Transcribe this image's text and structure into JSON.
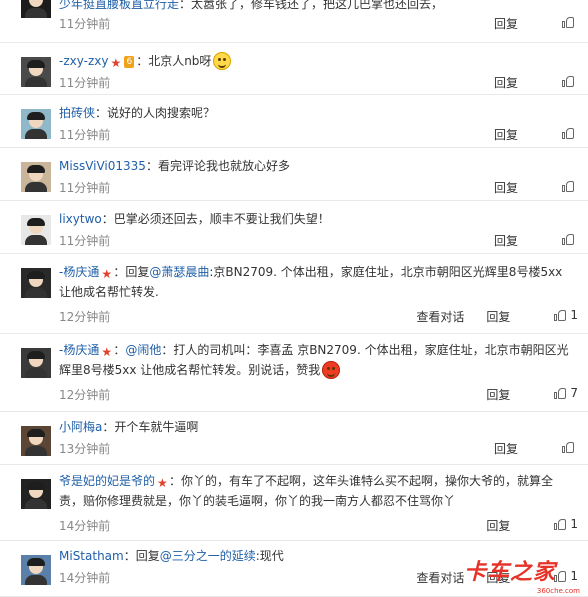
{
  "comments": [
    {
      "user": "少年挺直腰板直立行走",
      "vip": false,
      "parts": [
        {
          "t": "text",
          "v": "太嚣张了，修车钱还了，把这几巴掌也还回去，"
        }
      ],
      "time": "11分钟前",
      "actions": [
        "回复"
      ],
      "likes": ""
    },
    {
      "user": "-zxy-zxy",
      "vip": true,
      "badge": "6",
      "parts": [
        {
          "t": "text",
          "v": "北京人nb呀"
        },
        {
          "t": "emoji",
          "v": "smile"
        }
      ],
      "time": "11分钟前",
      "actions": [
        "回复"
      ],
      "likes": ""
    },
    {
      "user": "拍砖侠",
      "vip": false,
      "parts": [
        {
          "t": "text",
          "v": "说好的人肉搜索呢？"
        }
      ],
      "time": "11分钟前",
      "actions": [
        "回复"
      ],
      "likes": ""
    },
    {
      "user": "MissViVi01335",
      "vip": false,
      "parts": [
        {
          "t": "text",
          "v": "看完评论我也就放心好多"
        }
      ],
      "time": "11分钟前",
      "actions": [
        "回复"
      ],
      "likes": ""
    },
    {
      "user": "lixytwo",
      "vip": false,
      "parts": [
        {
          "t": "text",
          "v": "巴掌必须还回去，顺丰不要让我们失望！"
        }
      ],
      "time": "11分钟前",
      "actions": [
        "回复"
      ],
      "likes": ""
    },
    {
      "user": "-杨庆通",
      "vip": true,
      "parts": [
        {
          "t": "text",
          "v": "回复"
        },
        {
          "t": "mention",
          "v": "@萧瑟晨曲"
        },
        {
          "t": "text",
          "v": ":京BN2709. 个体出租，家庭住址，北京市朝阳区光辉里8号楼5xx 让他成名帮忙转发."
        }
      ],
      "time": "12分钟前",
      "actions": [
        "查看对话",
        "回复"
      ],
      "likes": "1"
    },
    {
      "user": "-杨庆通",
      "vip": true,
      "parts": [
        {
          "t": "mention",
          "v": "@闹他"
        },
        {
          "t": "text",
          "v": "：打人的司机叫：李喜孟 京BN2709. 个体出租，家庭住址，北京市朝阳区光辉里8号楼5xx 让他成名帮忙转发。别说话，赞我"
        },
        {
          "t": "emoji",
          "v": "angry"
        }
      ],
      "time": "12分钟前",
      "actions": [
        "回复"
      ],
      "likes": "7"
    },
    {
      "user": "小阿梅a",
      "vip": false,
      "parts": [
        {
          "t": "text",
          "v": "开个车就牛逼啊"
        }
      ],
      "time": "13分钟前",
      "actions": [
        "回复"
      ],
      "likes": ""
    },
    {
      "user": "爷是妃的妃是爷的",
      "vip": true,
      "parts": [
        {
          "t": "text",
          "v": "你丫的，有车了不起啊，这年头谁特么买不起啊，操你大爷的，就算全责，赔你修理费就是，你丫的装毛逼啊，你丫的我一南方人都忍不住骂你丫"
        }
      ],
      "time": "14分钟前",
      "actions": [
        "回复"
      ],
      "likes": "1"
    },
    {
      "user": "MiStatham",
      "vip": false,
      "parts": [
        {
          "t": "text",
          "v": "回复"
        },
        {
          "t": "mention",
          "v": "@三分之一的延续"
        },
        {
          "t": "text",
          "v": ":现代"
        }
      ],
      "time": "14分钟前",
      "actions": [
        "查看对话",
        "回复"
      ],
      "likes": "1"
    }
  ],
  "watermark": {
    "logo": "卡车之家",
    "url": "360che.com"
  },
  "colors": {
    "link": "#1f5fa8",
    "meta": "#888888",
    "vip": "#e0432c"
  }
}
